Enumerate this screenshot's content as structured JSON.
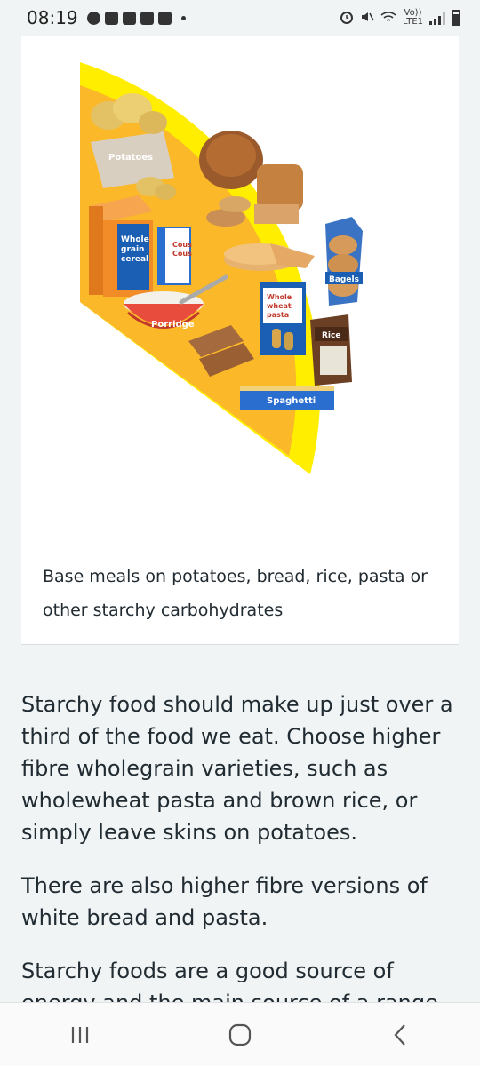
{
  "status_bar": {
    "time": "08:19",
    "left_icons": [
      "facebook-icon",
      "youtube-icon",
      "voicemail-icon",
      "usb-debug-icon",
      "mail-icon",
      "dot-icon"
    ],
    "right_icons": [
      "alarm-icon",
      "mute-icon",
      "wifi-icon",
      "volte-icon",
      "signal-icon",
      "battery-icon"
    ],
    "volte_top": "Vo))",
    "volte_bottom": "LTE1"
  },
  "illustration": {
    "labels": {
      "potatoes": "Potatoes",
      "cereal_1": "Whole",
      "cereal_2": "grain",
      "cereal_3": "cereal",
      "cous_1": "Cous",
      "cous_2": "Cous",
      "porridge": "Porridge",
      "pasta_1": "Whole",
      "pasta_2": "wheat",
      "pasta_3": "pasta",
      "bagels": "Bagels",
      "rice": "Rice",
      "spaghetti": "Spaghetti"
    },
    "colors": {
      "segment": "#fbb829",
      "rim": "#ffee00",
      "box_blue": "#1a5fb4",
      "box_orange": "#f28c28"
    }
  },
  "card": {
    "caption": "Base meals on potatoes, bread, rice, pasta or other starchy carbohydrates"
  },
  "content": {
    "paragraph_1": "Starchy food should make up just over a third of the food we eat. Choose higher fibre wholegrain varieties, such as wholewheat pasta and brown rice, or simply leave skins on potatoes.",
    "paragraph_2": "There are also higher fibre versions of white bread and pasta.",
    "paragraph_3": "Starchy foods are a good source of energy and the main source of a range of nutrients"
  },
  "nav_bar": {
    "buttons": [
      "recents-icon",
      "home-icon",
      "back-icon"
    ]
  }
}
